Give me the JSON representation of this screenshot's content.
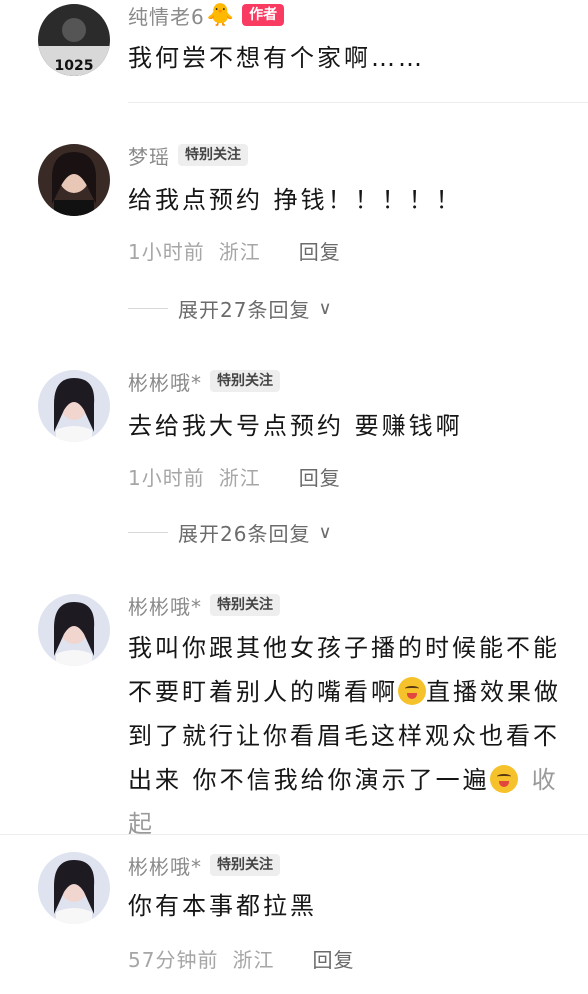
{
  "comments": [
    {
      "name": "纯情老6",
      "badge_emoji": "🐥",
      "tag": "作者",
      "text": "我何尝不想有个家啊……"
    },
    {
      "name": "梦瑶",
      "tag": "特别关注",
      "text": "给我点预约 挣钱！！！！！",
      "time": "1小时前",
      "location": "浙江",
      "reply": "回复",
      "expand": "展开27条回复"
    },
    {
      "name": "彬彬哦*",
      "tag": "特别关注",
      "text": "去给我大号点预约 要赚钱啊",
      "time": "1小时前",
      "location": "浙江",
      "reply": "回复",
      "expand": "展开26条回复"
    },
    {
      "name": "彬彬哦*",
      "tag": "特别关注",
      "text_a": "我叫你跟其他女孩子播的时候能不能不要盯着别人的嘴看啊",
      "text_b": "直播效果做到了就行让你看眉毛这样观众也看不出来 你不信我给你演示了一遍",
      "collapse": "收起"
    },
    {
      "name": "彬彬哦*",
      "tag": "特别关注",
      "text": "你有本事都拉黑",
      "time": "57分钟前",
      "location": "浙江",
      "reply": "回复"
    }
  ],
  "colors": {
    "author_tag": "#fa3b61",
    "name": "#8a8a8a"
  }
}
